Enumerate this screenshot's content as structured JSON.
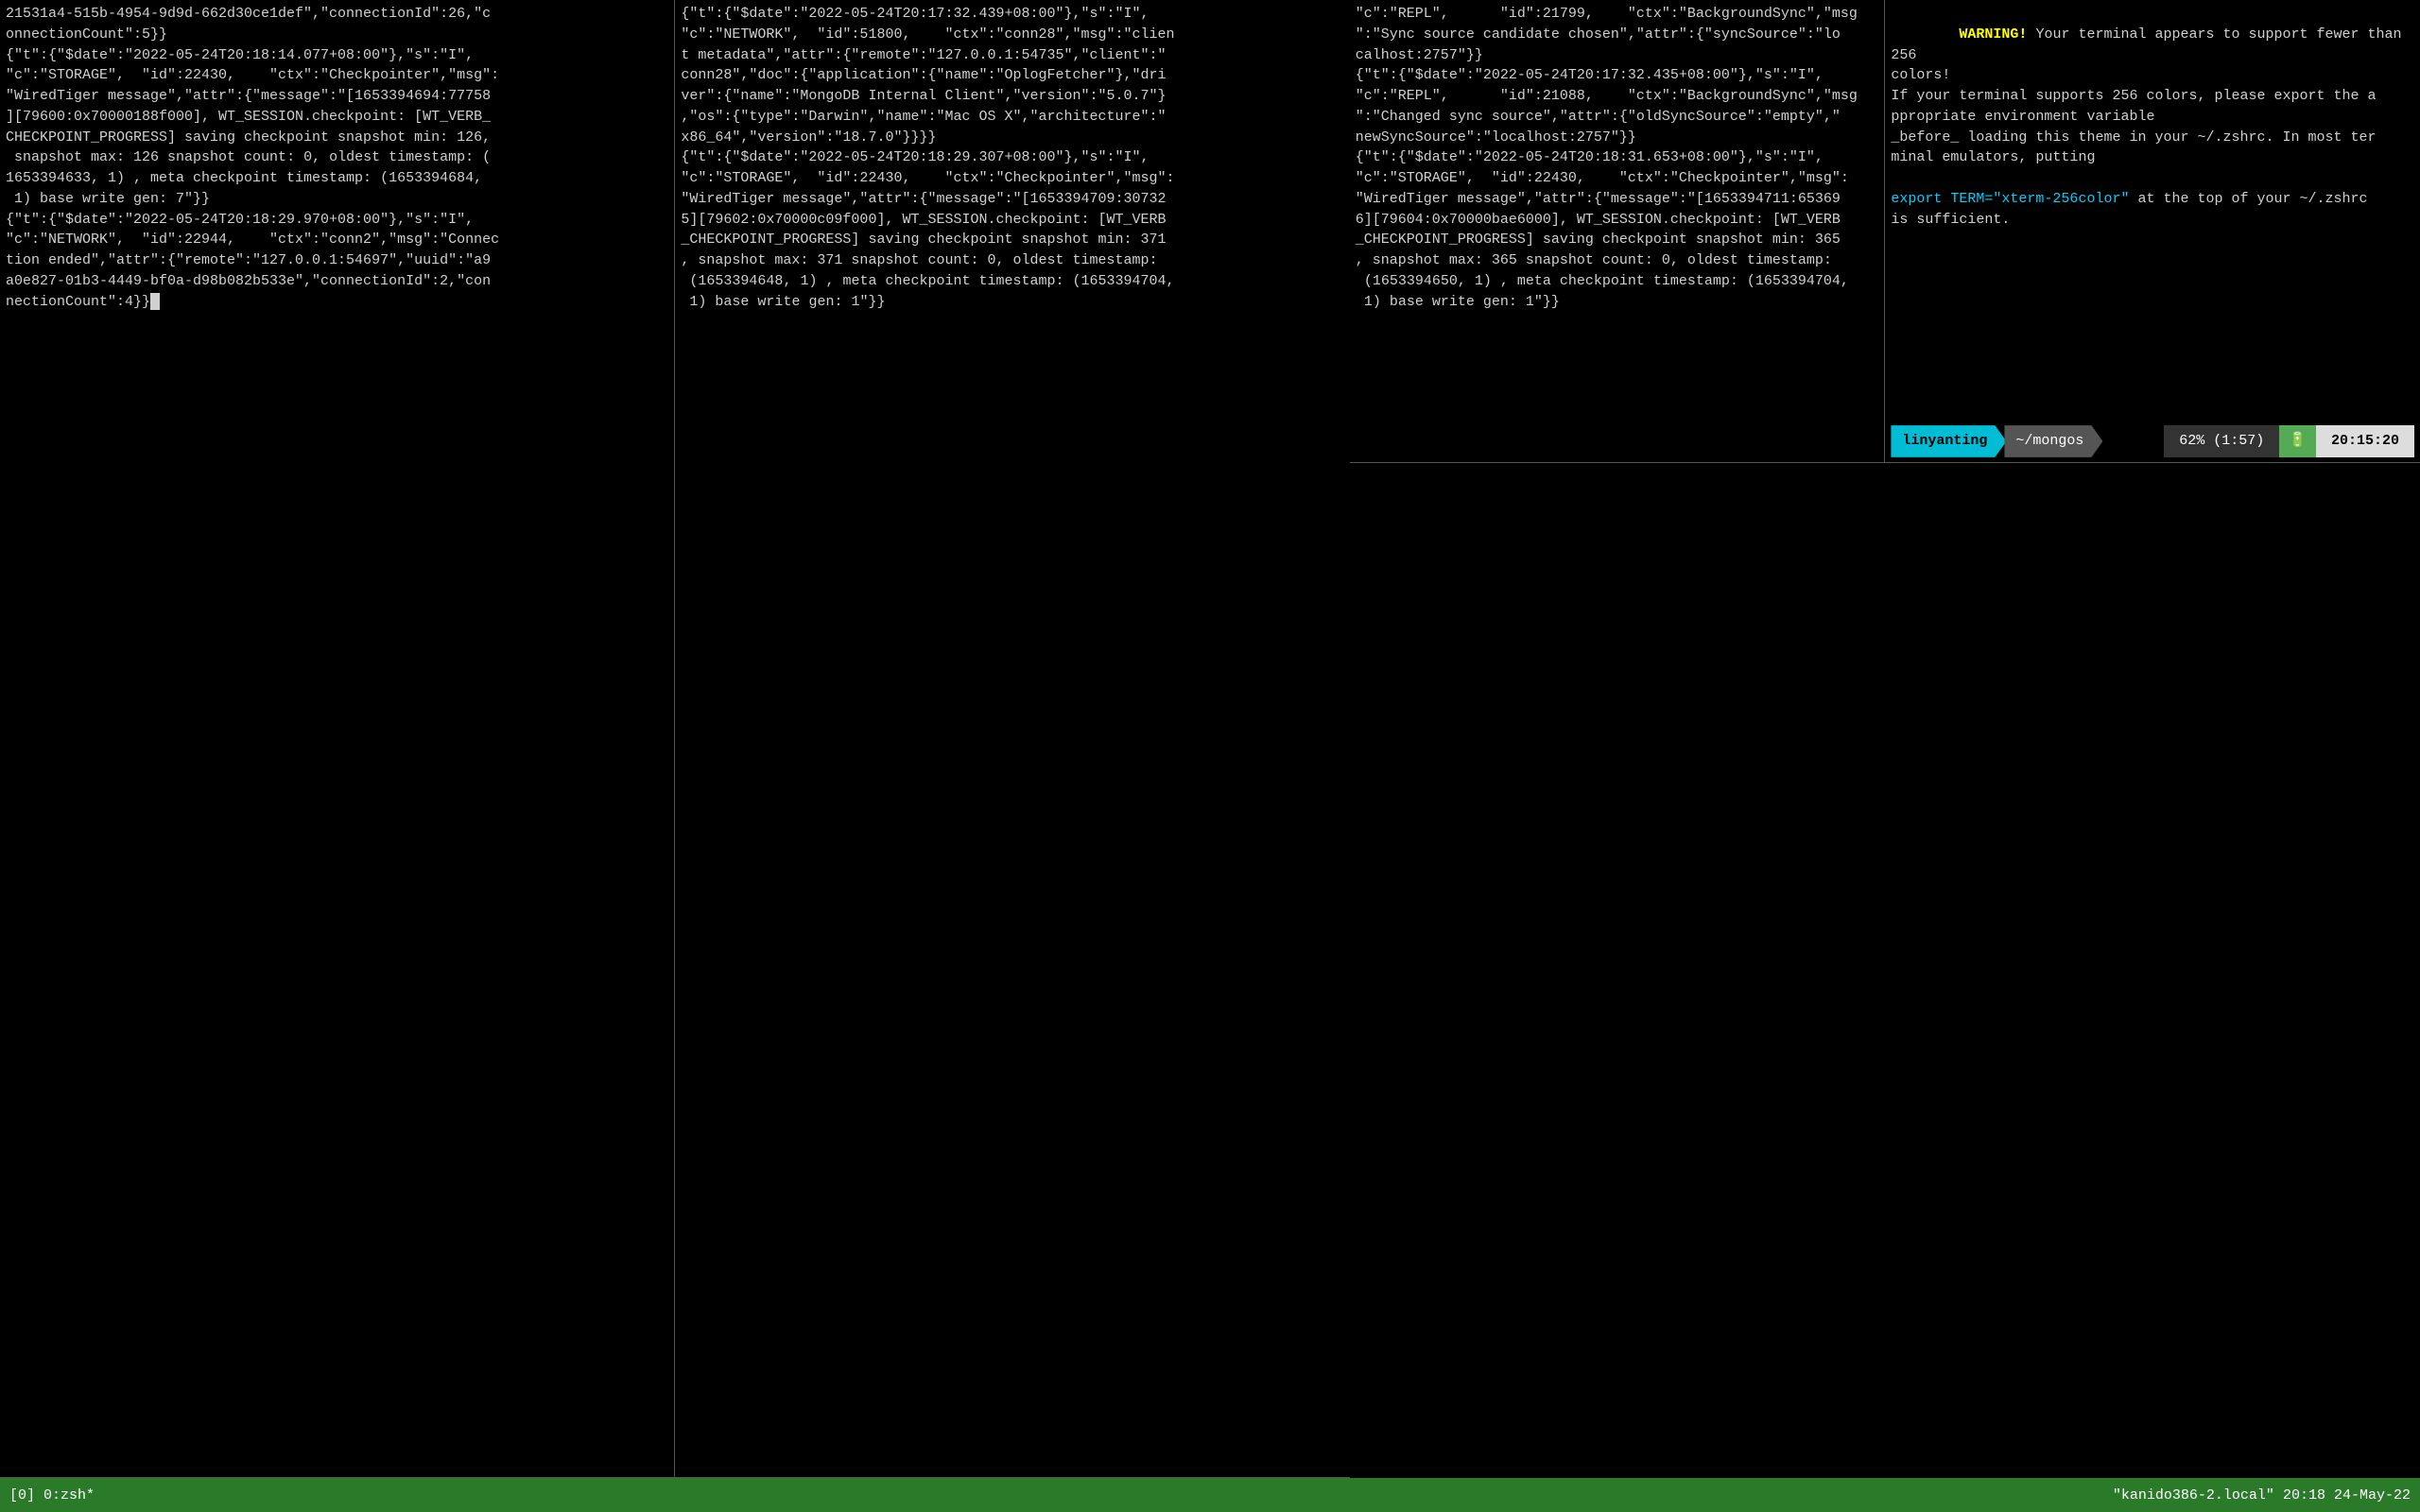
{
  "top_left_pane": {
    "content": "21531a4-515b-4954-9d9d-662d30ce1def\",\"connectionId\":26,\"c\nonnectionCount\":5}}\n{\"t\":{\"$date\":\"2022-05-24T20:18:14.077+08:00\"},\"s\":\"I\",\n\"c\":\"STORAGE\",  \"id\":22430,    \"ctx\":\"Checkpointer\",\"msg\":\n\"WiredTiger message\",\"attr\":{\"message\":\"[1653394694:77758\n][79600:0x70000188f000], WT_SESSION.checkpoint: [WT_VERB_\nCHECKPOINT_PROGRESS] saving checkpoint snapshot min: 126,\n snapshot max: 126 snapshot count: 0, oldest timestamp: (\n1653394633, 1) , meta checkpoint timestamp: (1653394684,\n 1) base write gen: 7\"}}\n{\"t\":{\"$date\":\"2022-05-24T20:18:29.970+08:00\"},\"s\":\"I\",\n\"c\":\"NETWORK\",  \"id\":22944,    \"ctx\":\"conn2\",\"msg\":\"Connec\ntion ended\",\"attr\":{\"remote\":\"127.0.0.1:54697\",\"uuid\":\"a9\na0e827-01b3-4449-bf0a-d98b082b533e\",\"connectionId\":2,\"con\nnectionCount\":4}}"
  },
  "top_right_pane": {
    "content": "{\"t\":{\"$date\":\"2022-05-24T20:17:32.439+08:00\"},\"s\":\"I\",\n\"c\":\"NETWORK\",  \"id\":51800,    \"ctx\":\"conn28\",\"msg\":\"clien\nt metadata\",\"attr\":{\"remote\":\"127.0.0.1:54735\",\"client\":\"\nconn28\",\"doc\":{\"application\":{\"name\":\"OplogFetcher\"},\"dri\nver\":{\"name\":\"MongoDB Internal Client\",\"version\":\"5.0.7\"}\n,\"os\":{\"type\":\"Darwin\",\"name\":\"Mac OS X\",\"architecture\":\"\nx86_64\",\"version\":\"18.7.0\"}}}}\n{\"t\":{\"$date\":\"2022-05-24T20:18:29.307+08:00\"},\"s\":\"I\",\n\"c\":\"STORAGE\",  \"id\":22430,    \"ctx\":\"Checkpointer\",\"msg\":\n\"WiredTiger message\",\"attr\":{\"message\":\"[1653394709:30732\n5][79602:0x70000c09f000], WT_SESSION.checkpoint: [WT_VERB\n_CHECKPOINT_PROGRESS] saving checkpoint snapshot min: 371\n, snapshot max: 371 snapshot count: 0, oldest timestamp:\n (1653394648, 1) , meta checkpoint timestamp: (1653394704,\n 1) base write gen: 1\"}}"
  },
  "bottom_left_pane": {
    "content": "\"c\":\"REPL\",      \"id\":21799,    \"ctx\":\"BackgroundSync\",\"msg\n\":\"Sync source candidate chosen\",\"attr\":{\"syncSource\":\"lo\ncalhost:2757\"}}\n{\"t\":{\"$date\":\"2022-05-24T20:17:32.435+08:00\"},\"s\":\"I\",\n\"c\":\"REPL\",      \"id\":21088,    \"ctx\":\"BackgroundSync\",\"msg\n\":\"Changed sync source\",\"attr\":{\"oldSyncSource\":\"empty\",\"\nnewSyncSource\":\"localhost:2757\"}}\n{\"t\":{\"$date\":\"2022-05-24T20:18:31.653+08:00\"},\"s\":\"I\",\n\"c\":\"STORAGE\",  \"id\":22430,    \"ctx\":\"Checkpointer\",\"msg\":\n\"WiredTiger message\",\"attr\":{\"message\":\"[1653394711:65369\n6][79604:0x70000bae6000], WT_SESSION.checkpoint: [WT_VERB\n_CHECKPOINT_PROGRESS] saving checkpoint snapshot min: 365\n, snapshot max: 365 snapshot count: 0, oldest timestamp:\n (1653394650, 1) , meta checkpoint timestamp: (1653394704,\n 1) base write gen: 1\"}}"
  },
  "bottom_right_pane": {
    "warning_label": "WARNING!",
    "warning_text": " Your terminal appears to support fewer than 256\ncolors!\nIf your terminal supports 256 colors, please export the a\nppropriate environment variable\n_before_ loading this theme in your ~/.zshrc. In most ter\nminal emulators, putting\n",
    "export_text": "export TERM=\"xterm-256color\"",
    "after_export": " at the top of your ~/.zshrc\nis sufficient.",
    "prompt_user": "linyanting",
    "prompt_path": "~/mongos",
    "percent": "62% (1:57)",
    "battery_icon": "🔋",
    "time": "20:15:20"
  },
  "status_bar": {
    "left": "[0] 0:zsh*",
    "right_file": "\"kanido386-2.local\"",
    "right_time": "20:18",
    "right_date": "24-May-22"
  }
}
